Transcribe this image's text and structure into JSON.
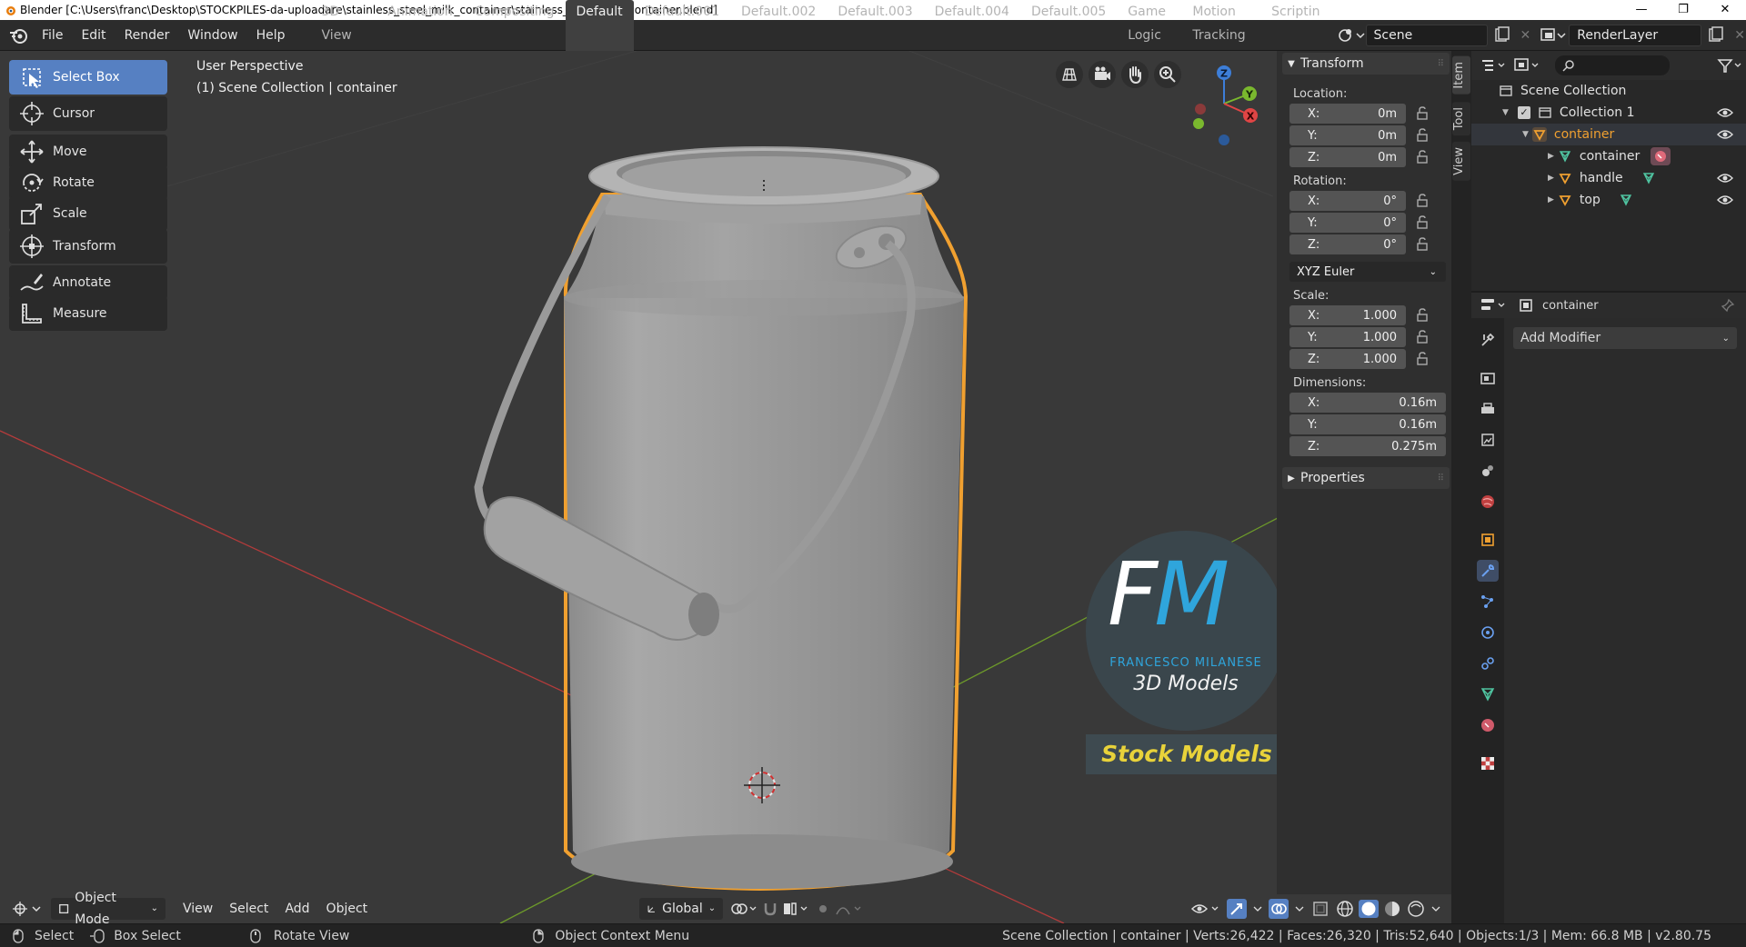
{
  "window": {
    "title": "Blender [C:\\Users\\franc\\Desktop\\STOCKPILES-da-uploadare\\stainless_steel_milk_container\\stainless_steel_milk_container.blend]",
    "minimize": "—",
    "maximize": "❐",
    "close": "✕"
  },
  "menu": [
    "File",
    "Edit",
    "Render",
    "Window",
    "Help"
  ],
  "workspaces": [
    {
      "label": "3D View Full",
      "active": false
    },
    {
      "label": "Animation",
      "active": false
    },
    {
      "label": "Compositing",
      "active": false
    },
    {
      "label": "Default",
      "active": true
    },
    {
      "label": "Default.001",
      "active": false
    },
    {
      "label": "Default.002",
      "active": false
    },
    {
      "label": "Default.003",
      "active": false
    },
    {
      "label": "Default.004",
      "active": false
    },
    {
      "label": "Default.005",
      "active": false
    },
    {
      "label": "Game Logic",
      "active": false
    },
    {
      "label": "Motion Tracking",
      "active": false
    },
    {
      "label": "Scriptin",
      "active": false
    }
  ],
  "scene_field": "Scene",
  "renderlayer_field": "RenderLayer",
  "toolbar": {
    "tools": [
      {
        "label": "Select Box",
        "icon": "select-box-icon",
        "active": true
      },
      {
        "label": "Cursor",
        "icon": "cursor-icon",
        "active": false
      },
      {
        "label": "Move",
        "icon": "move-icon",
        "active": false
      },
      {
        "label": "Rotate",
        "icon": "rotate-icon",
        "active": false
      },
      {
        "label": "Scale",
        "icon": "scale-icon",
        "active": false
      },
      {
        "label": "Transform",
        "icon": "transform-icon",
        "active": false
      },
      {
        "label": "Annotate",
        "icon": "annotate-icon",
        "active": false
      },
      {
        "label": "Measure",
        "icon": "measure-icon",
        "active": false
      }
    ]
  },
  "viewport": {
    "perspective": "User Perspective",
    "collection_info": "(1) Scene Collection | container",
    "watermark": {
      "logo": "FM",
      "author": "FRANCESCO MILANESE",
      "subtitle": "3D Models",
      "banner": "Stock Models"
    },
    "gizmo": {
      "x": "X",
      "y": "Y",
      "z": "Z"
    }
  },
  "viewport_header": {
    "mode": "Object Mode",
    "menus": [
      "View",
      "Select",
      "Add",
      "Object"
    ],
    "orientation": "Global"
  },
  "npanel": {
    "tabs": [
      "Item",
      "Tool",
      "View"
    ],
    "transform_title": "Transform",
    "location_label": "Location:",
    "location": [
      {
        "axis": "X:",
        "value": "0m"
      },
      {
        "axis": "Y:",
        "value": "0m"
      },
      {
        "axis": "Z:",
        "value": "0m"
      }
    ],
    "rotation_label": "Rotation:",
    "rotation": [
      {
        "axis": "X:",
        "value": "0°"
      },
      {
        "axis": "Y:",
        "value": "0°"
      },
      {
        "axis": "Z:",
        "value": "0°"
      }
    ],
    "rotation_mode": "XYZ Euler",
    "scale_label": "Scale:",
    "scale": [
      {
        "axis": "X:",
        "value": "1.000"
      },
      {
        "axis": "Y:",
        "value": "1.000"
      },
      {
        "axis": "Z:",
        "value": "1.000"
      }
    ],
    "dimensions_label": "Dimensions:",
    "dimensions": [
      {
        "axis": "X:",
        "value": "0.16m"
      },
      {
        "axis": "Y:",
        "value": "0.16m"
      },
      {
        "axis": "Z:",
        "value": "0.275m"
      }
    ],
    "properties_title": "Properties"
  },
  "outliner": {
    "rows": [
      {
        "label": "Scene Collection"
      },
      {
        "label": "Collection 1"
      },
      {
        "label": "container"
      },
      {
        "label": "container"
      },
      {
        "label": "handle"
      },
      {
        "label": "top"
      }
    ]
  },
  "properties": {
    "object_name": "container",
    "add_modifier": "Add Modifier"
  },
  "statusbar": {
    "select": "Select",
    "box_select": "Box Select",
    "rotate_view": "Rotate View",
    "context_menu": "Object Context Menu",
    "stats": "Scene Collection | container | Verts:26,422 | Faces:26,320 | Tris:52,640 | Objects:1/3 | Mem: 66.8 MB | v2.80.75"
  },
  "colors": {
    "selection_outline": "#f0a030",
    "active_tool": "#5680c2",
    "axis_x": "#e04545",
    "axis_y": "#7ab82e",
    "axis_z": "#3d7ed8"
  }
}
